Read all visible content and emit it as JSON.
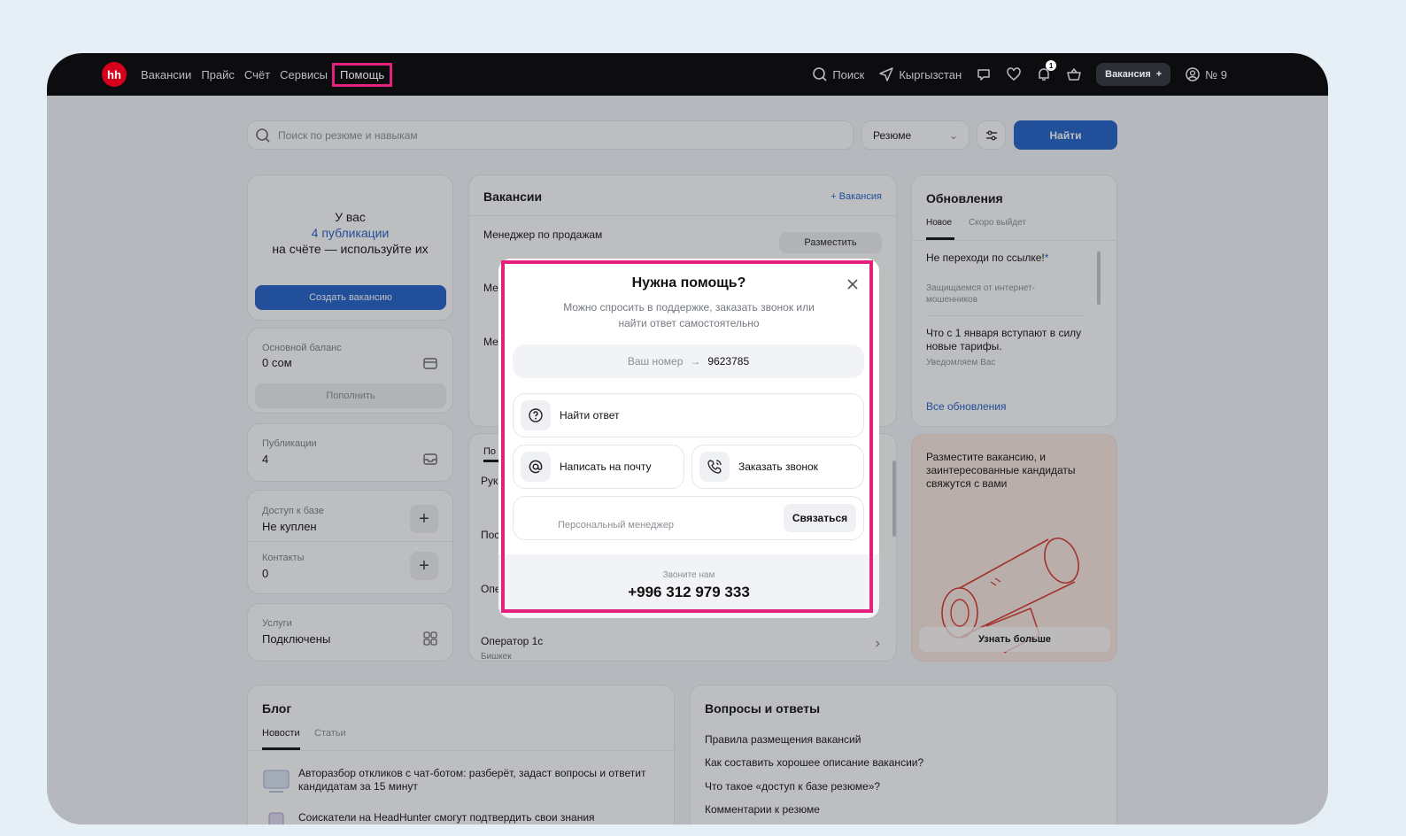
{
  "nav": {
    "logo": "hh",
    "items": [
      "Вакансии",
      "Прайс",
      "Счёт",
      "Сервисы"
    ],
    "help": "Помощь",
    "search": "Поиск",
    "region": "Кыргызстан",
    "notif_count": "1",
    "vacancy_btn": "Вакансия",
    "vacancy_plus": "+",
    "account": "№ 9"
  },
  "search": {
    "placeholder": "Поиск по резюме и навыкам",
    "type": "Резюме",
    "submit": "Найти"
  },
  "left": {
    "you_have": "У вас",
    "publications_link": "4 публикации",
    "on_account": "на счёте — используйте их",
    "create_btn": "Создать вакансию",
    "balance_label": "Основной баланс",
    "balance_value": "0 сом",
    "topup_btn": "Пополнить",
    "pubs_label": "Публикации",
    "pubs_value": "4",
    "db_label": "Доступ к базе",
    "db_value": "Не куплен",
    "contacts_label": "Контакты",
    "contacts_value": "0",
    "services_label": "Услуги",
    "services_value": "Подключены"
  },
  "vacancies": {
    "title": "Вакансии",
    "add": "+ Вакансия",
    "row1": "Менеджер по продажам",
    "publish_btn": "Разместить",
    "trunc_me": "Ме",
    "trunc_po": "По",
    "trunc_ruk": "Рук",
    "trunc_pos": "Пос",
    "trunc_ope": "Опе",
    "operator_title": "Оператор 1с",
    "operator_city": "Бишкек"
  },
  "updates": {
    "title": "Обновления",
    "tab_new": "Новое",
    "tab_soon": "Скоро выйдет",
    "item1_title": "Не переходи по ссылке!",
    "item1_sub": "Защищаемся от интернет-мошенников",
    "item2_title": "Что с 1 января вступают в силу новые тарифы.",
    "item2_sub": "Уведомляем Вас",
    "all": "Все обновления",
    "asterisk": "*"
  },
  "promo": {
    "text": "Разместите вакансию, и заинтересованные кандидаты свяжутся с вами",
    "btn": "Узнать больше"
  },
  "blog": {
    "title": "Блог",
    "tab_news": "Новости",
    "tab_articles": "Статьи",
    "item1": "Авторазбор откликов с чат-ботом: разберёт, задаст вопросы и ответит кандидатам за 15 минут",
    "item2": "Соискатели на HeadHunter смогут подтвердить свои знания"
  },
  "faq": {
    "title": "Вопросы и ответы",
    "q1": "Правила размещения вакансий",
    "q2": "Как составить хорошее описание вакансии?",
    "q3": "Что такое «доступ к базе резюме»?",
    "q4": "Комментарии к резюме"
  },
  "modal": {
    "title": "Нужна помощь?",
    "subtitle": "Можно спросить в поддержке, заказать звонок или найти ответ самостоятельно",
    "phone_label": "Ваш номер",
    "phone_arrow": "→",
    "phone_value": "9623785",
    "find_answer": "Найти ответ",
    "email": "Написать на почту",
    "callback": "Заказать звонок",
    "manager": "Персональный менеджер",
    "contact_btn": "Связаться",
    "call_us": "Звоните нам",
    "hotline": "+996 312 979 333"
  }
}
